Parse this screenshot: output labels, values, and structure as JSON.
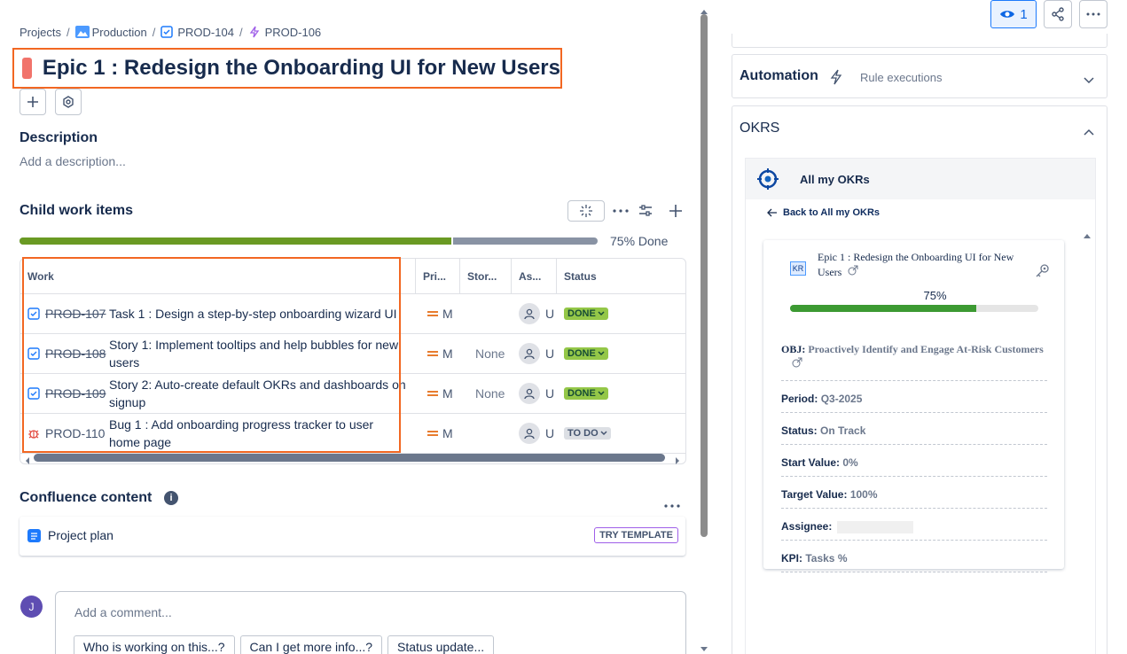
{
  "breadcrumbs": {
    "projects": "Projects",
    "production": "Production",
    "parent": "PROD-104",
    "current": "PROD-106",
    "separator": "/"
  },
  "issue": {
    "title": "Epic 1 : Redesign the Onboarding UI for New Users",
    "color": "#f1736b"
  },
  "description": {
    "heading": "Description",
    "placeholder": "Add a description..."
  },
  "child_items": {
    "heading": "Child work items",
    "progress_label": "75% Done",
    "progress": 0.75,
    "columns": [
      "Work",
      "Pri...",
      "Stor...",
      "As...",
      "Status"
    ],
    "rows": [
      {
        "key": "PROD-107",
        "type": "task",
        "summary": "Task 1 : Design a step-by-step onboarding wizard UI",
        "priority": "M",
        "story": "",
        "assignee": "U",
        "status": "DONE"
      },
      {
        "key": "PROD-108",
        "type": "task",
        "summary": "Story 1: Implement tooltips and help bubbles for new users",
        "priority": "M",
        "story": "None",
        "assignee": "U",
        "status": "DONE"
      },
      {
        "key": "PROD-109",
        "type": "task",
        "summary": "Story 2: Auto-create default OKRs and dashboards on signup",
        "priority": "M",
        "story": "None",
        "assignee": "U",
        "status": "DONE"
      },
      {
        "key": "PROD-110",
        "type": "bug",
        "summary": "Bug 1 : Add onboarding progress tracker to user home page",
        "priority": "M",
        "story": "",
        "assignee": "U",
        "status": "TO DO"
      }
    ]
  },
  "confluence": {
    "heading": "Confluence content",
    "item": "Project plan",
    "try_template": "TRY TEMPLATE"
  },
  "comment": {
    "avatar_initial": "J",
    "placeholder": "Add a comment...",
    "suggestions": [
      "Who is working on this...?",
      "Can I get more info...?",
      "Status update..."
    ]
  },
  "topbar": {
    "watch_count": "1"
  },
  "automation": {
    "title": "Automation",
    "subtitle": "Rule executions"
  },
  "okrs": {
    "title": "OKRS",
    "app_title": "All my OKRs",
    "back_label": "Back to All my OKRs",
    "kr_badge": "KR",
    "kr_title": "Epic 1 : Redesign the Onboarding UI for New Users",
    "kr_progress_label": "75%",
    "kr_progress": 0.75,
    "obj_label": "OBJ:",
    "obj_value": "Proactively Identify and Engage At-Risk Customers",
    "fields": [
      {
        "label": "Period:",
        "value": "Q3-2025"
      },
      {
        "label": "Status:",
        "value": "On Track"
      },
      {
        "label": "Start Value:",
        "value": "0%"
      },
      {
        "label": "Target Value:",
        "value": "100%"
      },
      {
        "label": "Assignee:",
        "value": ""
      },
      {
        "label": "KPI:",
        "value": "Tasks %"
      }
    ]
  }
}
